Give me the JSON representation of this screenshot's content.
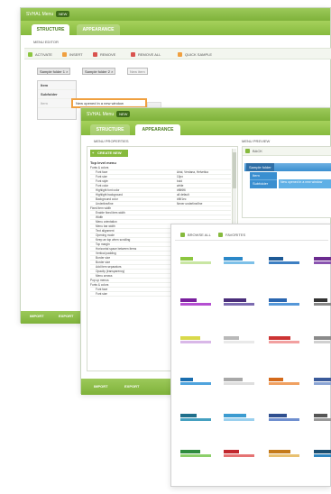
{
  "window1": {
    "title": "SVHAL Menu",
    "badge": "NEW",
    "tabs": [
      "STRUCTURE",
      "APPEARANCE"
    ],
    "section_label": "MENU EDITOR",
    "toolbar": [
      "ACTIVATE",
      "INSERT",
      "REMOVE",
      "REMOVE ALL",
      "QUICK SAMPLE"
    ],
    "chips": [
      "Sample folder 1 ×",
      "Sample folder 2 ×",
      "New item"
    ],
    "items": [
      "Item",
      "Subfolder",
      "Item"
    ],
    "popup_text": "New opened in a new window",
    "footer": [
      "IMPORT",
      "EXPORT"
    ]
  },
  "window2": {
    "title": "SVHAL Menu",
    "badge": "NEW",
    "tabs": [
      "STRUCTURE",
      "APPEARANCE"
    ],
    "props_header": "MENU PROPERTIES",
    "preview_header": "MENU PREVIEW",
    "create_button": "CREATE NEW",
    "top_label": "Top level menu",
    "rows": [
      {
        "k": "Fonts & colors",
        "v": ""
      },
      {
        "k": "Font face",
        "v": "Arial, Verdana, Helvetica"
      },
      {
        "k": "Font size",
        "v": "10px"
      },
      {
        "k": "Font style",
        "v": "bold"
      },
      {
        "k": "Font color",
        "v": "white"
      },
      {
        "k": "Highlight font color",
        "v": "#f6f6f6"
      },
      {
        "k": "Highlight background",
        "v": "all default"
      },
      {
        "k": "Background color",
        "v": "#f4f1ec"
      },
      {
        "k": "Underline/line",
        "v": "Never underline/line"
      },
      {
        "k": "Fixed item width",
        "v": ""
      },
      {
        "k": "Enable fixed item width",
        "v": ""
      },
      {
        "k": "Width",
        "v": ""
      },
      {
        "k": "Menu orientation",
        "v": ""
      },
      {
        "k": "Menu bar width",
        "v": ""
      },
      {
        "k": "Text alignment",
        "v": ""
      },
      {
        "k": "Opening mode",
        "v": ""
      },
      {
        "k": "Keep an top when scrolling",
        "v": ""
      },
      {
        "k": "Top margin",
        "v": ""
      },
      {
        "k": "Horizontal space between items",
        "v": ""
      },
      {
        "k": "Vertical padding",
        "v": ""
      },
      {
        "k": "Border size",
        "v": ""
      },
      {
        "k": "Border size",
        "v": ""
      },
      {
        "k": "Add item separators",
        "v": ""
      },
      {
        "k": "Opacity (transparency)",
        "v": ""
      },
      {
        "k": "Menu arrows",
        "v": ""
      },
      {
        "k": "Pop up menus",
        "v": ""
      },
      {
        "k": "Fonts & colors",
        "v": ""
      },
      {
        "k": "Font face",
        "v": ""
      },
      {
        "k": "Font size",
        "v": ""
      }
    ],
    "preview_back": "BACK",
    "preview_menu": [
      "Sample folder",
      "Item",
      "Subfolder"
    ],
    "preview_popup": "New opened in a new window",
    "footer": [
      "IMPORT",
      "EXPORT"
    ]
  },
  "window3": {
    "toolbar": [
      "BROWSE ALL",
      "FAVORITES"
    ],
    "themes": [
      {
        "label": "#8cc63f",
        "bar": "#c9e6a3"
      },
      {
        "label": "#2b88c8",
        "bar": "#7dc0e8"
      },
      {
        "label": "#1e5a96",
        "bar": "#3d7fc2"
      },
      {
        "label": "#6b2b8f",
        "bar": "#8a54b0"
      },
      {
        "label": "#7a1f9e",
        "bar": "#b44fd1"
      },
      {
        "label": "#4a2e7a",
        "bar": "#7c6bb0"
      },
      {
        "label": "#2a66b0",
        "bar": "#5597d8"
      },
      {
        "label": "#333333",
        "bar": "#888888"
      },
      {
        "label": "#d9d94a",
        "bar": "#d9b8e8"
      },
      {
        "label": "#b9b9b9",
        "bar": "#e9e9e9"
      },
      {
        "label": "#cc3333",
        "bar": "#f2a0a0"
      },
      {
        "label": "#8a8a8a",
        "bar": "#d0d0d0"
      },
      {
        "label": "#1a6eaf",
        "bar": "#4fa3dd"
      },
      {
        "label": "#a8a8a8",
        "bar": "#dedede"
      },
      {
        "label": "#d46a1a",
        "bar": "#f0a060"
      },
      {
        "label": "#3a5a9a",
        "bar": "#8aa4d4"
      },
      {
        "label": "#1f6f8b",
        "bar": "#45a0c0"
      },
      {
        "label": "#3b9bd0",
        "bar": "#9ad0ee"
      },
      {
        "label": "#2f4f8f",
        "bar": "#6f8fcf"
      },
      {
        "label": "#555555",
        "bar": "#999999"
      },
      {
        "label": "#2e8b3e",
        "bar": "#8ccf6a"
      },
      {
        "label": "#c1272d",
        "bar": "#e57373"
      },
      {
        "label": "#c47a1a",
        "bar": "#e8c070"
      },
      {
        "label": "#1b4f72",
        "bar": "#2e86c1"
      }
    ]
  },
  "colors": {
    "green": "#86ba3d",
    "dark_green": "#4c7d20",
    "orange": "#f0a040",
    "blue": "#3a8fd0"
  }
}
